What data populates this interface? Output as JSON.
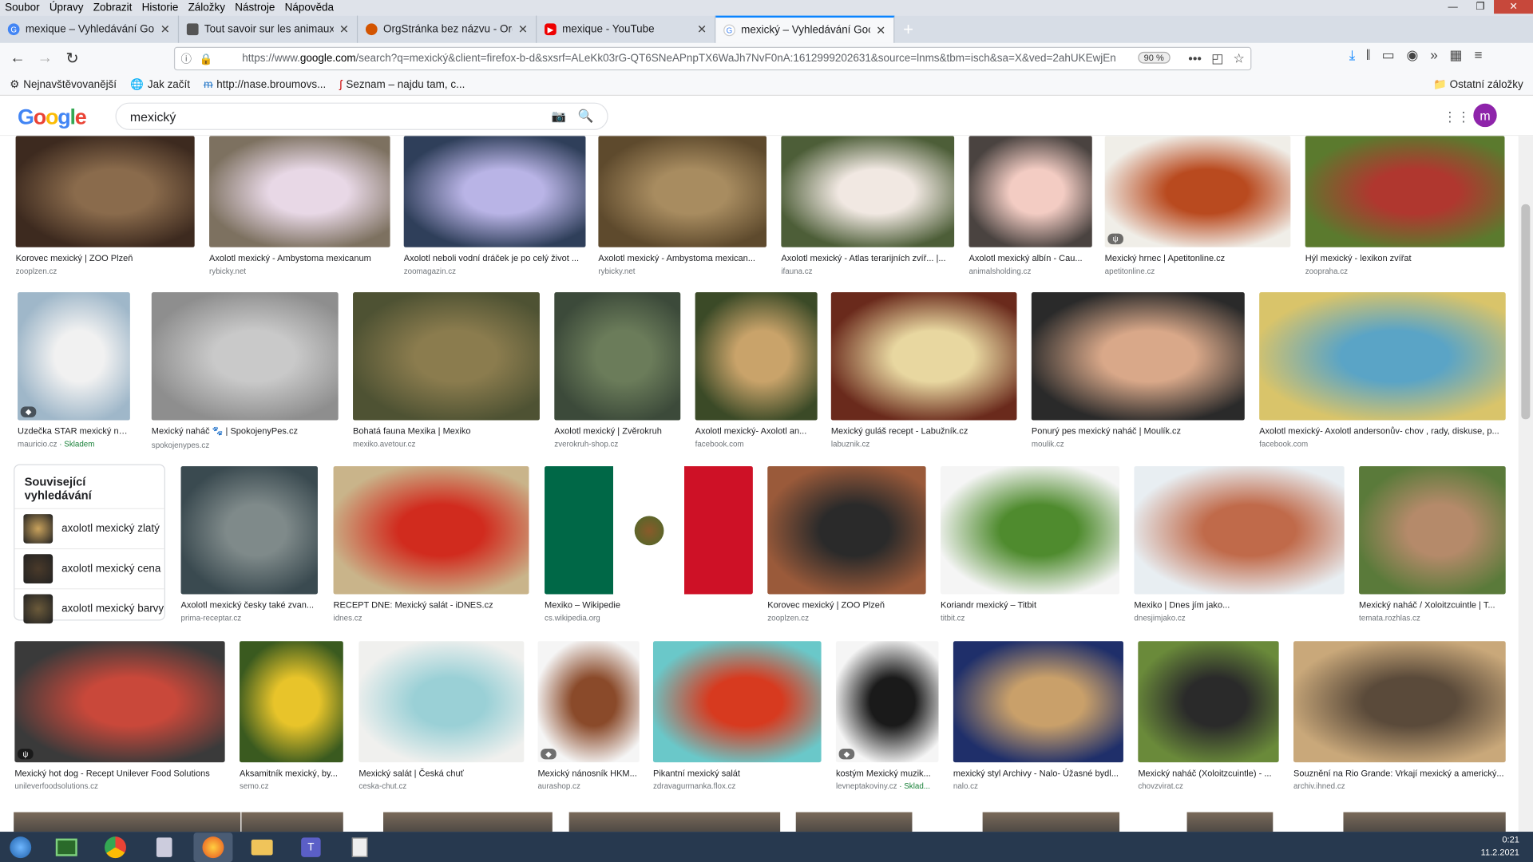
{
  "menubar": {
    "items": [
      "Soubor",
      "Úpravy",
      "Zobrazit",
      "Historie",
      "Záložky",
      "Nástroje",
      "Nápověda"
    ]
  },
  "tabs": [
    {
      "title": "mexique – Vyhledávání Google",
      "color": "#4285f4",
      "active": false
    },
    {
      "title": "Tout savoir sur les animaux les",
      "color": "#444",
      "active": false
    },
    {
      "title": "OrgStránka bez názvu - OrgPad",
      "color": "#d35400",
      "active": false
    },
    {
      "title": "mexique - YouTube",
      "color": "#e00",
      "active": false
    },
    {
      "title": "mexický – Vyhledávání Google",
      "color": "#4285f4",
      "active": true
    }
  ],
  "navbar": {
    "url_prefix": "https://www.",
    "url_domain": "google.com",
    "url_rest": "/search?q=mexický&client=firefox-b-d&sxsrf=ALeKk03rG-QT6SNeAPnpTX6WaJh7NvF0nA:1612999202631&source=lnms&tbm=isch&sa=X&ved=2ahUKEwjEn",
    "zoom": "90 %"
  },
  "bookmarks": {
    "items": [
      "Nejnavštěvovanější",
      "Jak začít",
      "http://nase.broumovs...",
      "Seznam – najdu tam, c..."
    ],
    "other": "Ostatní záložky"
  },
  "google": {
    "logo": "Google",
    "query": "mexický",
    "avatar": "m"
  },
  "related": {
    "title": "Související vyhledávání",
    "items": [
      {
        "label": "axolotl mexický zlatý",
        "color": "#c9a25c"
      },
      {
        "label": "axolotl mexický cena",
        "color": "#4a3a2a"
      },
      {
        "label": "axolotl mexický barvy",
        "color": "#6b5a3a"
      }
    ]
  },
  "results": [
    {
      "cap": "Korovec mexický | ZOO Plzeň",
      "src": "zooplzen.cz",
      "c1": "#3d2a1f",
      "c2": "#8a6b4c"
    },
    {
      "cap": "Axolotl mexický - Ambystoma mexicanum",
      "src": "rybicky.net",
      "c1": "#7d7160",
      "c2": "#e8d8e6"
    },
    {
      "cap": "Axolotl neboli vodní dráček je po celý život ...",
      "src": "zoomagazin.cz",
      "c1": "#2f3f5a",
      "c2": "#b9b4e6"
    },
    {
      "cap": "Axolotl mexický - Ambystoma mexican...",
      "src": "rybicky.net",
      "c1": "#5e4a2d",
      "c2": "#a88c60"
    },
    {
      "cap": "Axolotl mexický - Atlas terarijních zvíř... |...",
      "src": "ifauna.cz",
      "c1": "#4d5e38",
      "c2": "#f1e8e2"
    },
    {
      "cap": "Axolotl mexický albín - Cau...",
      "src": "animalsholding.cz",
      "c1": "#4a4340",
      "c2": "#f3ccc3"
    },
    {
      "cap": "Mexický hrnec | Apetitonline.cz",
      "src": "apetitonline.cz",
      "c1": "#f0eee8",
      "c2": "#b94a1f",
      "badge": "ψ"
    },
    {
      "cap": "Hýl mexický - lexikon zvířat",
      "src": "zoopraha.cz",
      "c1": "#5b7a2e",
      "c2": "#b0372f"
    },
    {
      "cap": "Uzdečka STAR mexický nán...",
      "src": "mauricio.cz",
      "src_green": " · Skladem",
      "c1": "#9fb7c9",
      "c2": "#f1f1f1",
      "badge": "◆"
    },
    {
      "cap": "Mexický naháč 🐾 | SpokojenyPes.cz",
      "src": "spokojenypes.cz",
      "c1": "#8e8e8e",
      "c2": "#c9c9c9"
    },
    {
      "cap": "Bohatá fauna Mexika | Mexiko",
      "src": "mexiko.avetour.cz",
      "c1": "#4e5233",
      "c2": "#8b7c4e"
    },
    {
      "cap": "Axolotl mexický | Zvěrokruh",
      "src": "zverokruh-shop.cz",
      "c1": "#3c4a3a",
      "c2": "#6b7c5a"
    },
    {
      "cap": "Axolotl mexický- Axolotl an...",
      "src": "facebook.com",
      "c1": "#3b4a27",
      "c2": "#c9a36a"
    },
    {
      "cap": "Mexický guláš recept - Labužník.cz",
      "src": "labuznik.cz",
      "c1": "#6a2a1c",
      "c2": "#e8d7a0"
    },
    {
      "cap": "Ponurý pes mexický naháč | Moulík.cz",
      "src": "moulik.cz",
      "c1": "#2a2a2a",
      "c2": "#d9a889"
    },
    {
      "cap": "Axolotl mexický- Axolotl andersonův- chov , rady, diskuse, p...",
      "src": "facebook.com",
      "c1": "#d9c46a",
      "c2": "#5aa4c6"
    },
    {
      "cap": "Axolotl mexický česky také zvan...",
      "src": "prima-receptar.cz",
      "c1": "#3a4a50",
      "c2": "#7f8a8a"
    },
    {
      "cap": "RECEPT DNE: Mexický salát - iDNES.cz",
      "src": "idnes.cz",
      "c1": "#c9b48a",
      "c2": "#d12b1e"
    },
    {
      "cap": "Mexiko – Wikipedie",
      "src": "cs.wikipedia.org",
      "flag": true
    },
    {
      "cap": "Korovec mexický | ZOO Plzeň",
      "src": "zooplzen.cz",
      "c1": "#9a5a3a",
      "c2": "#2a2a2a"
    },
    {
      "cap": "Koriandr mexický – Titbit",
      "src": "titbit.cz",
      "c1": "#f5f5f5",
      "c2": "#4f8b2e"
    },
    {
      "cap": "Mexiko | Dnes jím jako...",
      "src": "dnesjimjako.cz",
      "c1": "#e8eef2",
      "c2": "#c06a4a"
    },
    {
      "cap": "Mexický naháč / Xoloitzcuintle | T...",
      "src": "temata.rozhlas.cz",
      "c1": "#5a7a3a",
      "c2": "#b58a6a"
    },
    {
      "cap": "Mexický hot dog - Recept Unilever Food Solutions",
      "src": "unileverfoodsolutions.cz",
      "c1": "#3a3a3a",
      "c2": "#c9483a",
      "badge": "ψ"
    },
    {
      "cap": "Aksamitník mexický, by...",
      "src": "semo.cz",
      "c1": "#3a5a1f",
      "c2": "#e8c42a"
    },
    {
      "cap": "Mexický salát | Česká chuť",
      "src": "ceska-chut.cz",
      "c1": "#f0f0ee",
      "c2": "#9ad0d6"
    },
    {
      "cap": "Mexický nánosník HKM...",
      "src": "aurashop.cz",
      "c1": "#f5f5f5",
      "c2": "#8a4a2a",
      "badge": "◆"
    },
    {
      "cap": "Pikantní mexický salát",
      "src": "zdravagurmanka.flox.cz",
      "c1": "#6ac8c9",
      "c2": "#d73a1f"
    },
    {
      "cap": "kostým Mexický muzik...",
      "src": "levneptakoviny.cz",
      "src_green": " · Sklad...",
      "c1": "#f5f5f5",
      "c2": "#1a1a1a",
      "badge": "◆"
    },
    {
      "cap": "mexický styl Archivy - Nalo- Úžasné bydl...",
      "src": "nalo.cz",
      "c1": "#1f2f6a",
      "c2": "#c9a06a"
    },
    {
      "cap": "Mexický naháč (Xoloitzcuintle) - ...",
      "src": "chovzvirat.cz",
      "c1": "#6a8a3a",
      "c2": "#2a2a2a"
    },
    {
      "cap": "Souznění na Rio Grande: Vrkají mexický a americký...",
      "src": "archiv.ihned.cz",
      "c1": "#c9a87a",
      "c2": "#5a4a3a"
    }
  ],
  "taskbar": {
    "time": "0:21",
    "date": "11.2.2021"
  }
}
